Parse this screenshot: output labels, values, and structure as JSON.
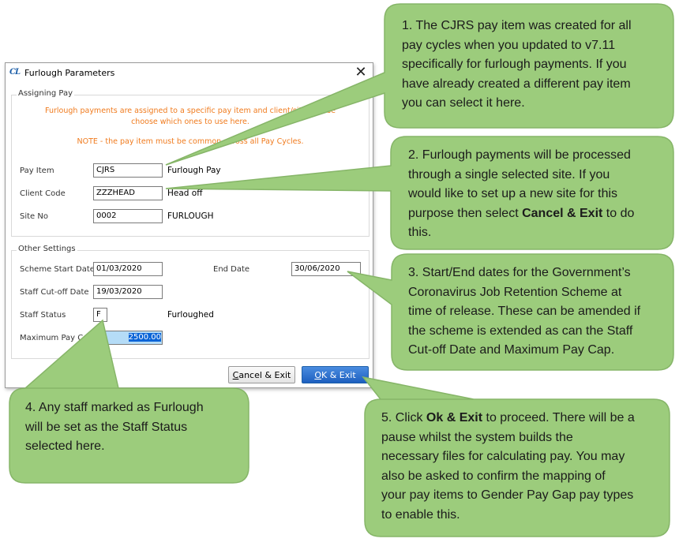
{
  "dialog": {
    "title": "Furlough Parameters",
    "logo_text": "CL",
    "close_glyph": "✕",
    "assigning_pay": {
      "group_label": "Assigning Pay",
      "notice_line1": "Furlough payments are assigned to a specific pay item and client/site. Please",
      "notice_line2": "choose which ones to use here.",
      "note": "NOTE - the pay item must be common across all Pay Cycles.",
      "pay_item_label": "Pay Item",
      "pay_item_value": "CJRS",
      "pay_item_desc": "Furlough Pay",
      "client_code_label": "Client Code",
      "client_code_value": "ZZZHEAD",
      "client_code_desc": "Head off",
      "site_no_label": "Site No",
      "site_no_value": "0002",
      "site_no_desc": "FURLOUGH"
    },
    "other_settings": {
      "group_label": "Other Settings",
      "scheme_start_label": "Scheme Start Date",
      "scheme_start_value": "01/03/2020",
      "end_date_label": "End Date",
      "end_date_value": "30/06/2020",
      "cutoff_label": "Staff Cut-off Date",
      "cutoff_value": "19/03/2020",
      "status_label": "Staff Status",
      "status_value": "F",
      "status_desc": "Furloughed",
      "max_pay_label": "Maximum Pay Cap",
      "max_pay_value": "2500.00"
    },
    "buttons": {
      "cancel_hotkey": "C",
      "cancel_rest": "ancel & Exit",
      "ok_hotkey": "O",
      "ok_rest": "K & Exit"
    }
  },
  "callouts": {
    "c1": [
      "1. The CJRS pay item was created for all",
      "pay cycles when you updated to v7.11",
      "specifically for furlough payments. If you",
      "have already created a different pay item",
      "you can select it here."
    ],
    "c2": {
      "lines": [
        "2. Furlough payments will be processed",
        "through a single selected site. If you",
        "would like to set up a new site for this"
      ],
      "line4_pre": "purpose then select ",
      "line4_bold": "Cancel & Exit",
      "line4_post": " to do",
      "line5": "this."
    },
    "c3": [
      "3. Start/End dates for the Government’s",
      "Coronavirus Job Retention Scheme at",
      "time of release. These can be amended if",
      "the scheme is extended as can the Staff",
      "Cut-off Date and Maximum Pay Cap."
    ],
    "c4": [
      "4. Any staff marked as Furlough",
      "will be set as the Staff Status",
      "selected here."
    ],
    "c5": {
      "line1_pre": "5. Click ",
      "line1_bold": "Ok & Exit",
      "line1_post": " to proceed. There will be a",
      "lines": [
        "pause whilst the system builds the",
        "necessary files for calculating pay. You may",
        "also be asked to confirm the mapping of",
        "your pay items to Gender Pay Gap pay types",
        "to enable this."
      ]
    }
  },
  "colors": {
    "callout_fill": "#9ccc7c",
    "callout_stroke": "#86b568",
    "notice_orange": "#f07b1e",
    "ok_button_blue": "#1d5fbf"
  }
}
